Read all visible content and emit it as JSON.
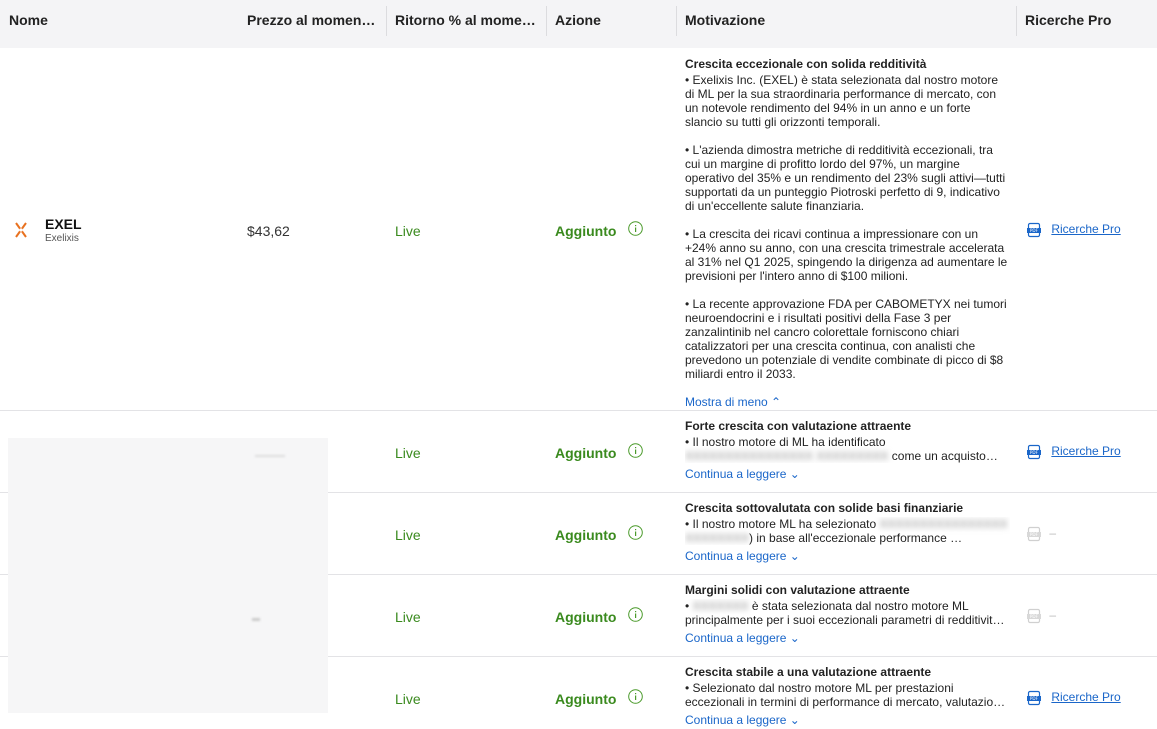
{
  "columns": {
    "name": "Nome",
    "price": "Prezzo al momen…",
    "return": "Ritorno % al mome…",
    "action": "Azione",
    "motivation": "Motivazione",
    "pro": "Ricerche Pro"
  },
  "rows": [
    {
      "ticker": "EXEL",
      "company": "Exelixis",
      "price": "$43,62",
      "return": "Live",
      "action": "Aggiunto",
      "motivation_title": "Crescita eccezionale con solida redditività",
      "paragraphs": [
        "• Exelixis Inc. (EXEL) è stata selezionata dal nostro motore di ML per la sua straordinaria performance di mercato, con un notevole rendimento del 94% in un anno e un forte slancio su tutti gli orizzonti temporali.",
        "• L'azienda dimostra metriche di redditività eccezionali, tra cui un margine di profitto lordo del 97%, un margine operativo del 35% e un rendimento del 23% sugli attivi—tutti supportati da un punteggio Piotroski perfetto di 9, indicativo di un'eccellente salute finanziaria.",
        "• La crescita dei ricavi continua a impressionare con un +24% anno su anno, con una crescita trimestrale accelerata al 31% nel Q1 2025, spingendo la dirigenza ad aumentare le previsioni per l'intero anno di $100 milioni.",
        "• La recente approvazione FDA per CABOMETYX nei tumori neuroendocrini e i risultati positivi della Fase 3 per zanzalintinib nel cancro colorettale forniscono chiari catalizzatori per una crescita continua, con analisti che prevedono un potenziale di vendite combinate di picco di $8 miliardi entro il 2033."
      ],
      "toggle": "Mostra di meno",
      "pro_label": "Ricerche Pro"
    },
    {
      "return": "Live",
      "action": "Aggiunto",
      "motivation_title": "Forte crescita con valutazione attraente",
      "snippet_pre": "• Il nostro motore di ML ha identificato",
      "snippet_blur": "XXXXXXXXXXXXXXXX XXXXXXXXX",
      "snippet_post": "come un acquisto convincente basato su…",
      "toggle": "Continua a leggere",
      "pro_label": "Ricerche Pro"
    },
    {
      "return": "Live",
      "action": "Aggiunto",
      "motivation_title": "Crescita sottovalutata con solide basi finanziarie",
      "snippet_pre": "• Il nostro motore ML ha selezionato",
      "snippet_blur": "XXXXXXXXXXXXXXXX XXXXXXXX",
      "snippet_post": ") in base all'eccezionale performance …",
      "toggle": "Continua a leggere",
      "pro_label": "–"
    },
    {
      "return": "Live",
      "action": "Aggiunto",
      "motivation_title": "Margini solidi con valutazione attraente",
      "snippet_pre": "•",
      "snippet_blur": "XXXXXXX",
      "snippet_post": "è stata selezionata dal nostro motore ML principalmente per i suoi eccezionali parametri di redditivit…",
      "toggle": "Continua a leggere",
      "pro_label": "–"
    },
    {
      "return": "Live",
      "action": "Aggiunto",
      "motivation_title": "Crescita stabile a una valutazione attraente",
      "snippet_pre": "• Selezionato dal nostro motore ML per prestazioni eccezionali in termini di performance di mercato, valutazio…",
      "snippet_blur": "",
      "snippet_post": "",
      "toggle": "Continua a leggere",
      "pro_label": "Ricerche Pro"
    }
  ],
  "colors": {
    "live_green": "#3a8a1e",
    "link_blue": "#1a66c9",
    "header_bg": "#f4f4f6",
    "brand_orange": "#e8711f"
  }
}
